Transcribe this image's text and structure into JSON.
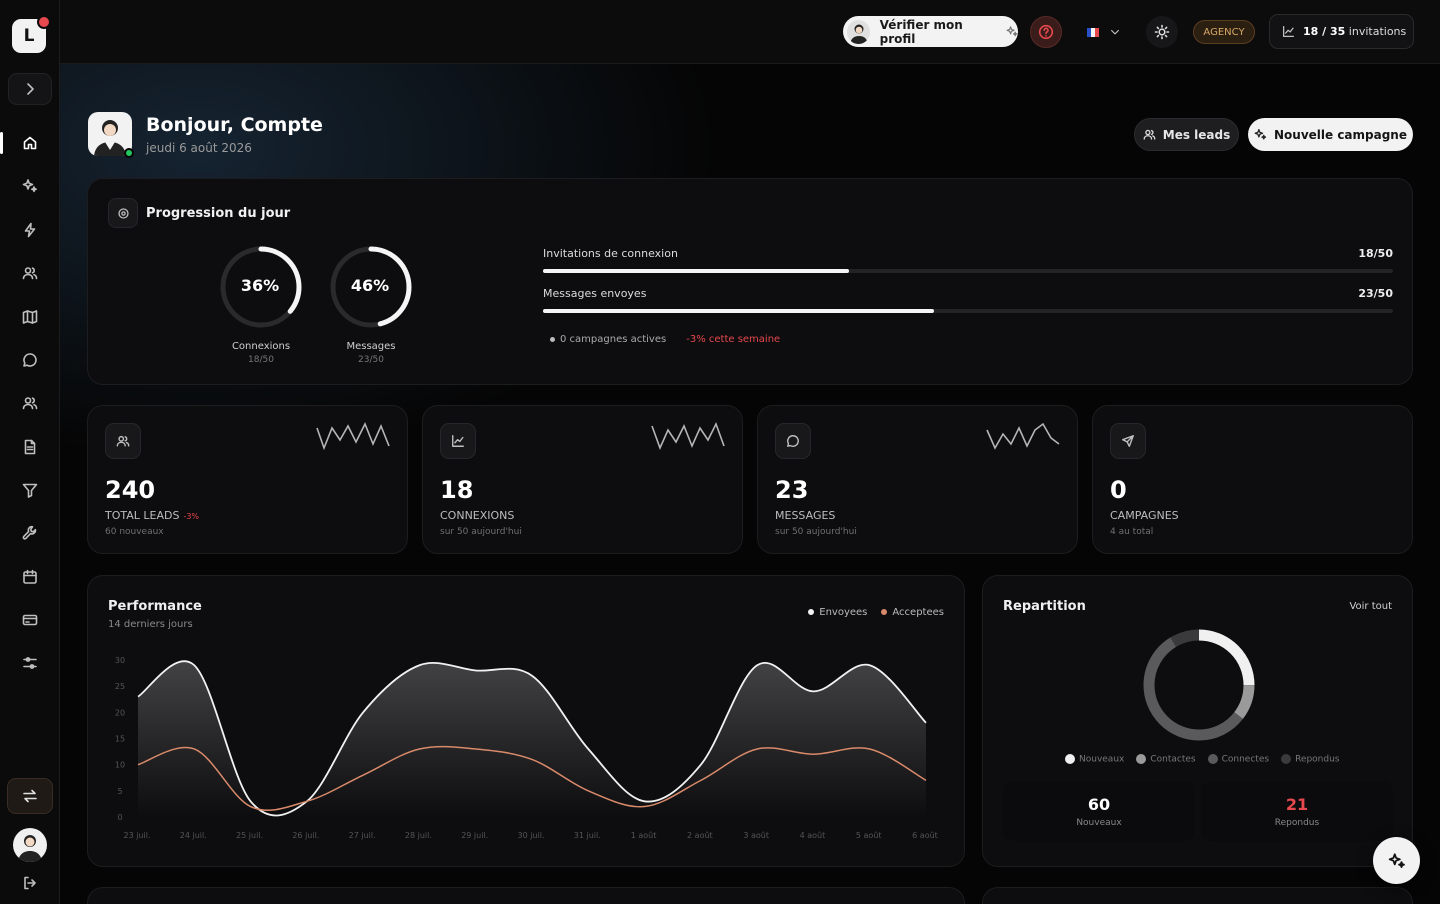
{
  "sidebar": {
    "logo_letter": "L",
    "nav_icons": [
      "home-icon",
      "sparkles-icon",
      "bolt-icon",
      "users-icon",
      "map-icon",
      "chat-icon",
      "contacts-icon",
      "document-icon",
      "filter-icon",
      "wrench-icon",
      "calendar-icon",
      "credit-card-icon",
      "sliders-icon"
    ],
    "active_item": "home-icon"
  },
  "topbar": {
    "verify_label": "Vérifier mon profil",
    "plan_badge": "AGENCY",
    "invitations_used": "18",
    "invitations_total": "35",
    "invitations_sep": " / ",
    "invitations_unit": " invitations"
  },
  "header": {
    "greeting": "Bonjour, Compte",
    "date": "jeudi 6 août 2026",
    "leads_button": "Mes leads",
    "campaign_button": "Nouvelle campagne"
  },
  "progress": {
    "title": "Progression du jour",
    "rings": [
      {
        "pct_label": "36%",
        "fraction": 0.36,
        "label": "Connexions",
        "sub": "18/50"
      },
      {
        "pct_label": "46%",
        "fraction": 0.46,
        "label": "Messages",
        "sub": "23/50"
      }
    ],
    "bars": [
      {
        "label": "Invitations de connexion",
        "value": "18/50",
        "fraction": 0.36
      },
      {
        "label": "Messages envoyes",
        "value": "23/50",
        "fraction": 0.46
      }
    ],
    "active_campaigns": "0 campagnes actives",
    "weekly_change": "-3% cette semaine"
  },
  "stats": [
    {
      "icon": "users-icon",
      "value": "240",
      "label": "TOTAL LEADS",
      "change": "-3%",
      "sub": "60 nouveaux"
    },
    {
      "icon": "chart-line-icon",
      "value": "18",
      "label": "CONNEXIONS",
      "change": "",
      "sub": "sur 50 aujourd'hui"
    },
    {
      "icon": "chat-icon",
      "value": "23",
      "label": "MESSAGES",
      "change": "",
      "sub": "sur 50 aujourd'hui"
    },
    {
      "icon": "send-icon",
      "value": "0",
      "label": "CAMPAGNES",
      "change": "",
      "sub": "4 au total"
    }
  ],
  "performance": {
    "title": "Performance",
    "subtitle": "14 derniers jours",
    "legend_sent": "Envoyees",
    "legend_accepted": "Acceptees"
  },
  "chart_data": {
    "type": "area",
    "title": "Performance",
    "categories": [
      "23 juil.",
      "24 juil.",
      "25 juil.",
      "26 juil.",
      "27 juil.",
      "28 juil.",
      "29 juil.",
      "30 juil.",
      "31 juil.",
      "1 août",
      "2 août",
      "3 août",
      "4 août",
      "5 août",
      "6 août"
    ],
    "y_ticks": [
      30,
      25,
      20,
      15,
      10,
      5,
      0
    ],
    "ylim": [
      0,
      30
    ],
    "series": [
      {
        "name": "Envoyees",
        "color": "#f2f2f2",
        "values": [
          23,
          29,
          3,
          3,
          20,
          29,
          28,
          27,
          13,
          3,
          10,
          29,
          24,
          29,
          18
        ]
      },
      {
        "name": "Acceptees",
        "color": "#d98a6a",
        "values": [
          10,
          13,
          2,
          3,
          8,
          13,
          13,
          11,
          5,
          2,
          7,
          13,
          12,
          13,
          7
        ]
      }
    ],
    "grid": false,
    "legend": "top-right"
  },
  "repartition": {
    "title": "Repartition",
    "link": "Voir tout",
    "legend": [
      "Nouveaux",
      "Contactes",
      "Connectes",
      "Repondus"
    ],
    "segments": [
      {
        "name": "Nouveaux",
        "value": 60,
        "color": "#f0f0f0"
      },
      {
        "name": "Contactes",
        "value": 25,
        "color": "#9a9a9a"
      },
      {
        "name": "Connectes",
        "value": 134,
        "color": "#5a5a5d"
      },
      {
        "name": "Repondus",
        "value": 21,
        "color": "#3a3a3d"
      }
    ],
    "box_new_value": "60",
    "box_new_label": "Nouveaux",
    "box_replied_value": "21",
    "box_replied_label": "Repondus"
  },
  "colors": {
    "negative": "#e5484d",
    "accepted": "#d98a6a",
    "online": "#22c55e",
    "agency": "#d9a766"
  }
}
